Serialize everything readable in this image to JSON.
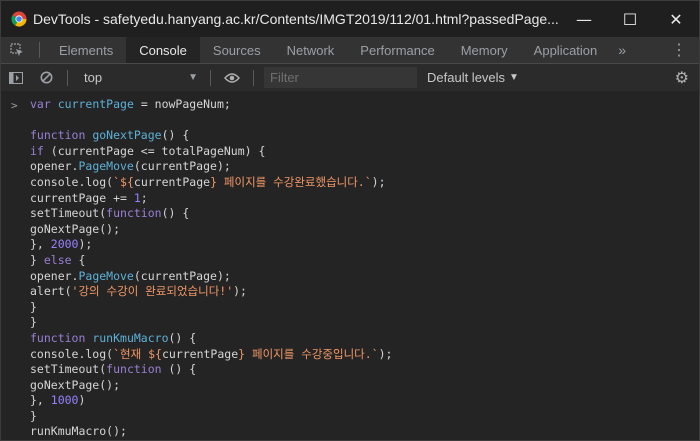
{
  "window": {
    "title": "DevTools - safetyedu.hanyang.ac.kr/Contents/IMGT2019/112/01.html?passedPage...",
    "controls": {
      "minimize": "—",
      "maximize": "☐",
      "close": "✕"
    }
  },
  "tabs": [
    {
      "label": "Elements"
    },
    {
      "label": "Console"
    },
    {
      "label": "Sources"
    },
    {
      "label": "Network"
    },
    {
      "label": "Performance"
    },
    {
      "label": "Memory"
    },
    {
      "label": "Application"
    }
  ],
  "tab_overflow": "»",
  "active_tab": "Console",
  "toolbar": {
    "context": "top",
    "filter_placeholder": "Filter",
    "levels": "Default levels"
  },
  "console": {
    "prompt": ">",
    "code_lines": [
      "var currentPage = nowPageNum;",
      "",
      "function goNextPage() {",
      "if (currentPage <= totalPageNum) {",
      "opener.PageMove(currentPage);",
      "console.log(`${currentPage} 페이지를 수강완료했습니다.`);",
      "currentPage += 1;",
      "setTimeout(function() {",
      "goNextPage();",
      "}, 2000);",
      "} else {",
      "opener.PageMove(currentPage);",
      "alert('강의 수강이 완료되었습니다!');",
      "}",
      "}",
      "function runKmuMacro() {",
      "console.log(`현재 ${currentPage} 페이지를 수강중입니다.`);",
      "setTimeout(function () {",
      "goNextPage();",
      "}, 1000)",
      "}",
      "runKmuMacro();"
    ]
  }
}
